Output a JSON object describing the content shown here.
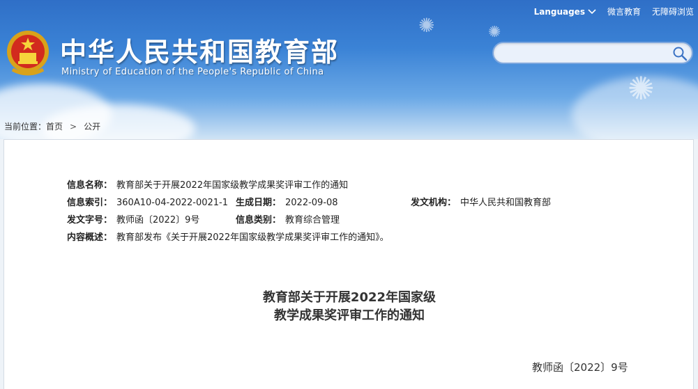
{
  "header": {
    "top_links": {
      "languages": "Languages",
      "weibo": "微言教育",
      "accessibility": "无障碍浏览"
    },
    "site_title_cn": "中华人民共和国教育部",
    "site_title_en": "Ministry of Education of the People's Republic of China",
    "search": {
      "placeholder": "",
      "value": ""
    }
  },
  "breadcrumb": {
    "prefix": "当前位置：",
    "home": "首页",
    "separator": ">",
    "current": "公开"
  },
  "meta": {
    "name_label": "信息名称：",
    "name_value": "教育部关于开展2022年国家级教学成果奖评审工作的通知",
    "index_label": "信息索引：",
    "index_value": "360A10-04-2022-0021-1",
    "date_label": "生成日期：",
    "date_value": "2022-09-08",
    "org_label": "发文机构：",
    "org_value": "中华人民共和国教育部",
    "docno_label": "发文字号：",
    "docno_value": "教师函〔2022〕9号",
    "category_label": "信息类别：",
    "category_value": "教育综合管理",
    "summary_label": "内容概述：",
    "summary_value": "教育部发布《关于开展2022年国家级教学成果奖评审工作的通知》。"
  },
  "document": {
    "title_line1": "教育部关于开展2022年国家级",
    "title_line2": "教学成果奖评审工作的通知",
    "doc_number": "教师函〔2022〕9号"
  },
  "icons": {
    "emblem": "national-emblem-icon",
    "search": "search-icon",
    "languages_dropdown": "chevron-down-icon",
    "breadcrumb_separator": "chevron-right-icon"
  }
}
